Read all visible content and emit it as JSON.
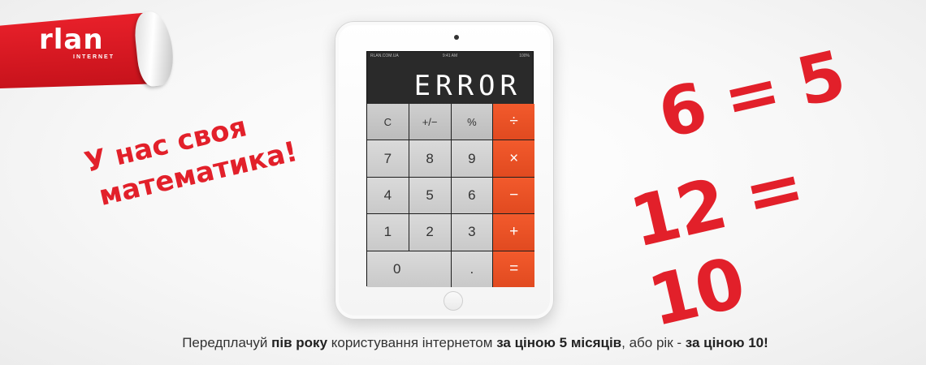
{
  "logo": {
    "mark": "rlan",
    "sub": "INTERNET"
  },
  "slogan": {
    "line1": "У нас своя",
    "line2": "математика!"
  },
  "equations": {
    "first": "6 = 5",
    "second": "12 = 10"
  },
  "tablet": {
    "status_left": "RLAN.COM.UA",
    "status_time": "9:41 AM",
    "status_battery": "100%",
    "display": "ERROR",
    "keys": [
      {
        "label": "C",
        "kind": "top"
      },
      {
        "label": "+/−",
        "kind": "top"
      },
      {
        "label": "%",
        "kind": "top"
      },
      {
        "label": "÷",
        "kind": "op"
      },
      {
        "label": "7",
        "kind": "num"
      },
      {
        "label": "8",
        "kind": "num"
      },
      {
        "label": "9",
        "kind": "num"
      },
      {
        "label": "×",
        "kind": "op"
      },
      {
        "label": "4",
        "kind": "num"
      },
      {
        "label": "5",
        "kind": "num"
      },
      {
        "label": "6",
        "kind": "num"
      },
      {
        "label": "−",
        "kind": "op"
      },
      {
        "label": "1",
        "kind": "num"
      },
      {
        "label": "2",
        "kind": "num"
      },
      {
        "label": "3",
        "kind": "num"
      },
      {
        "label": "+",
        "kind": "op"
      },
      {
        "label": "0",
        "kind": "zero"
      },
      {
        "label": ".",
        "kind": "num"
      },
      {
        "label": "=",
        "kind": "op"
      }
    ]
  },
  "tagline": {
    "p1": "Передплачуй ",
    "b1": "пів року",
    "p2": " користування інтернетом ",
    "b2": "за ціною 5 місяців",
    "p3": ", або рік - ",
    "b3": "за ціною 10!"
  },
  "colors": {
    "brand_red": "#e2202a",
    "operator_orange": "#f25a2c"
  }
}
